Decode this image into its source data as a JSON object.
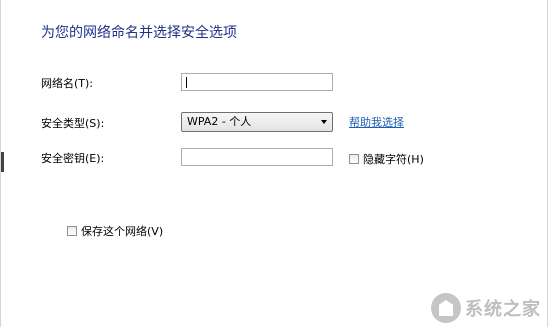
{
  "heading": "为您的网络命名并选择安全选项",
  "network_name": {
    "label": "网络名(T):",
    "value": ""
  },
  "security_type": {
    "label": "安全类型(S):",
    "selected": "WPA2 - 个人",
    "help_link": "帮助我选择"
  },
  "security_key": {
    "label": "安全密钥(E):",
    "value": "",
    "hide_chars_label": "隐藏字符(H)",
    "hide_chars_checked": false
  },
  "save_network": {
    "label": "保存这个网络(V)",
    "checked": false
  },
  "watermark": {
    "text": "系统之家"
  },
  "colors": {
    "heading": "#1e3287",
    "link": "#1a5fb4"
  }
}
